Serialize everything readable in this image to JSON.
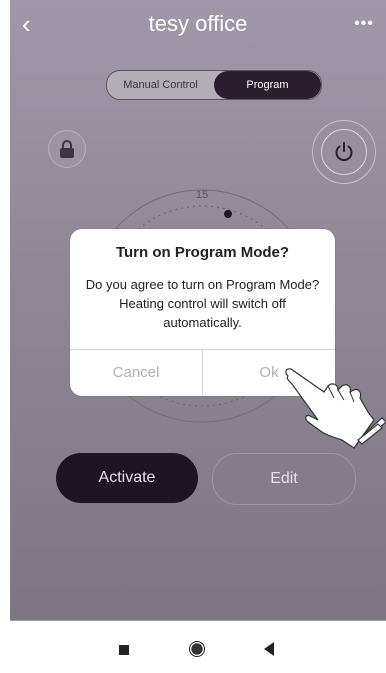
{
  "header": {
    "back_icon": "‹",
    "title": "tesy office",
    "more_icon": "•••"
  },
  "mode_switch": {
    "manual_label": "Manual Control",
    "program_label": "Program",
    "selected": "Program"
  },
  "dial": {
    "tick_label": "15"
  },
  "actions": {
    "activate_label": "Activate",
    "edit_label": "Edit"
  },
  "dialog": {
    "title": "Turn on Program Mode?",
    "message": "Do you agree to turn on Program Mode? Heating control will switch off automatically.",
    "cancel_label": "Cancel",
    "ok_label": "Ok"
  },
  "icons": {
    "lock": "lock-icon",
    "power": "power-icon",
    "pointer": "hand-pointer-icon",
    "nav_recent": "square-icon",
    "nav_home": "circle-icon",
    "nav_back": "triangle-back-icon"
  },
  "colors": {
    "app_background": "#8f8796",
    "active_segment": "#2b1e2f",
    "activate_button": "#1f1522",
    "dialog_background": "#ffffff"
  }
}
